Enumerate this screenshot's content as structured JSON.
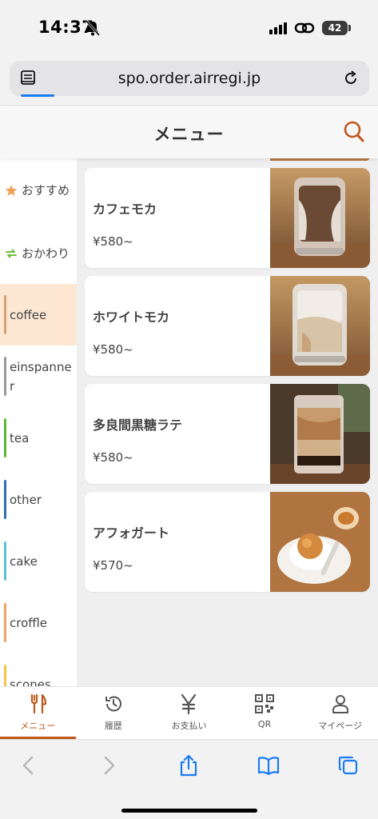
{
  "status": {
    "time": "14:37",
    "battery": "42"
  },
  "browser": {
    "url": "spo.order.airregi.jp"
  },
  "header": {
    "title": "メニュー"
  },
  "sidebar": {
    "items": [
      {
        "label": "おすすめ",
        "icon": "star-icon",
        "color": "#f0a050"
      },
      {
        "label": "おかわり",
        "icon": "refill-icon",
        "color": "#6bbf3a"
      },
      {
        "label": "coffee",
        "color": "#d9a073",
        "active": true
      },
      {
        "label": "einspanner",
        "color": "#999999"
      },
      {
        "label": "tea",
        "color": "#5fb83a"
      },
      {
        "label": "other",
        "color": "#2f6fb3"
      },
      {
        "label": "cake",
        "color": "#5bc0de"
      },
      {
        "label": "croffle",
        "color": "#f0a060"
      },
      {
        "label": "scones",
        "color": "#f5c542"
      }
    ]
  },
  "menu": {
    "items": [
      {
        "name": "カフェモカ",
        "price": "¥580~"
      },
      {
        "name": "ホワイトモカ",
        "price": "¥580~"
      },
      {
        "name": "多良間黒糖ラテ",
        "price": "¥580~"
      },
      {
        "name": "アフォガート",
        "price": "¥570~"
      }
    ]
  },
  "tabbar": {
    "items": [
      {
        "label": "メニュー",
        "icon": "cutlery-icon",
        "active": true
      },
      {
        "label": "履歴",
        "icon": "history-icon"
      },
      {
        "label": "お支払い",
        "icon": "yen-icon"
      },
      {
        "label": "QR",
        "icon": "qr-icon"
      },
      {
        "label": "マイページ",
        "icon": "person-icon"
      }
    ]
  },
  "colors": {
    "accent": "#c0571b",
    "active_bg": "#fde7d2"
  }
}
